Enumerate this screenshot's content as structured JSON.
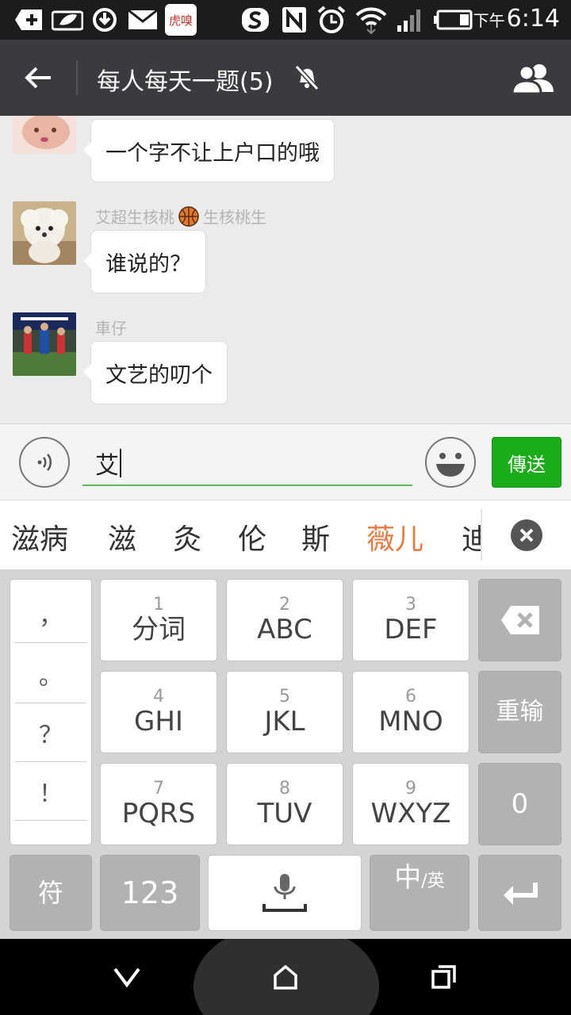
{
  "status_bar": {
    "time": "6:14",
    "ampm": "下午",
    "app_badge_text": "虎嗅"
  },
  "header": {
    "title": "每人每天一题(5)"
  },
  "messages": [
    {
      "sender": "",
      "text": "一个字不让上户口的哦"
    },
    {
      "sender_part1": "艾超生核桃",
      "sender_part2": "生核桃生",
      "text": "谁说的？"
    },
    {
      "sender": "車仔",
      "text": "文艺的叨个"
    }
  ],
  "composer": {
    "input_value": "艾",
    "send_label": "傳送"
  },
  "candidates": {
    "items": [
      "滋病",
      "滋",
      "灸",
      "伦",
      "斯",
      "薇儿",
      "迪"
    ],
    "highlighted_index": 5
  },
  "keyboard": {
    "punctuation": [
      "，",
      "。",
      "？",
      "！"
    ],
    "keys": [
      {
        "num": "1",
        "label": "分词"
      },
      {
        "num": "2",
        "label": "ABC"
      },
      {
        "num": "3",
        "label": "DEF"
      },
      {
        "num": "4",
        "label": "GHI"
      },
      {
        "num": "5",
        "label": "JKL"
      },
      {
        "num": "6",
        "label": "MNO"
      },
      {
        "num": "7",
        "label": "PQRS"
      },
      {
        "num": "8",
        "label": "TUV"
      },
      {
        "num": "9",
        "label": "WXYZ"
      }
    ],
    "retype_label": "重输",
    "zero_label": "0",
    "symbol_label": "符",
    "numbers_label": "123",
    "lang_main": "中",
    "lang_alt": "/英"
  },
  "colors": {
    "send_green": "#1aad19",
    "highlight_orange": "#ee7a43",
    "titlebar": "#3a3b3e",
    "input_underline": "#5cb85c"
  },
  "icons": {
    "back": "arrow-left-icon",
    "mute": "bell-off-icon",
    "members": "group-icon",
    "voice": "voice-icon",
    "emoji": "smiley-icon",
    "backspace": "backspace-icon",
    "mic": "microphone-icon",
    "enter": "enter-icon"
  }
}
